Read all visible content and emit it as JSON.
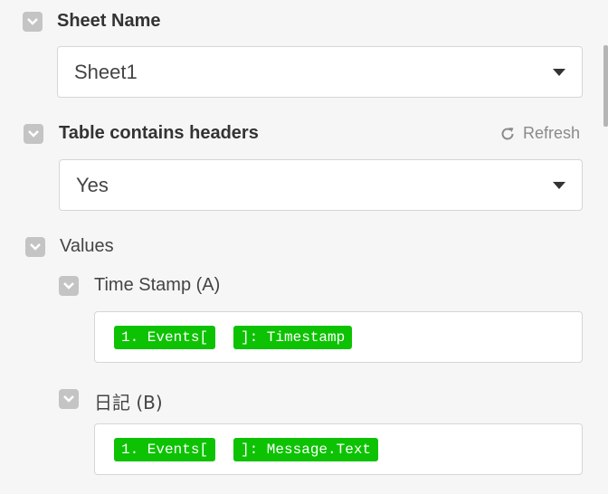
{
  "sheet_name": {
    "label": "Sheet Name",
    "value": "Sheet1"
  },
  "headers": {
    "label": "Table contains headers",
    "value": "Yes",
    "refresh_label": "Refresh"
  },
  "values": {
    "label": "Values",
    "fields": [
      {
        "label": "Time Stamp (A)",
        "tokens": [
          "1. Events[",
          "]: Timestamp"
        ]
      },
      {
        "label": "日記 (B)",
        "tokens": [
          "1. Events[",
          "]: Message.Text"
        ]
      }
    ]
  },
  "colors": {
    "token_green": "#0dc203",
    "checkbox_gray": "#c4c4c4",
    "background": "#f6f6f6"
  }
}
